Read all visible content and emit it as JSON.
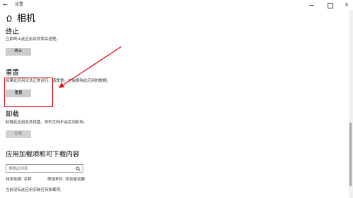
{
  "window": {
    "title": "设置",
    "back_glyph": "←",
    "close_glyph": "✕"
  },
  "page": {
    "title": "相机"
  },
  "terminate": {
    "heading": "终止",
    "description": "立即终止此应用及其相关进程。",
    "button": "终止"
  },
  "reset": {
    "heading": "重置",
    "description": "如果此应用无法正常运行，请重置。这会删除此应用的数据。",
    "button": "重置"
  },
  "uninstall": {
    "heading": "卸载",
    "description": "卸载此应用及其设置。你的文档不会受到影响。",
    "button": "卸载"
  },
  "addons": {
    "heading": "应用加载项和可下载内容",
    "search_placeholder": "搜索此列表",
    "sort_by": "排序依据: 名称",
    "filter_by": "筛选条件: 所有驱动器",
    "note": "当前没有此应用安装任何加载项。"
  },
  "annotation": {
    "color": "#e3121a"
  },
  "colors": {
    "button_bg": "#cccccc",
    "accent_red": "#e3121a"
  }
}
